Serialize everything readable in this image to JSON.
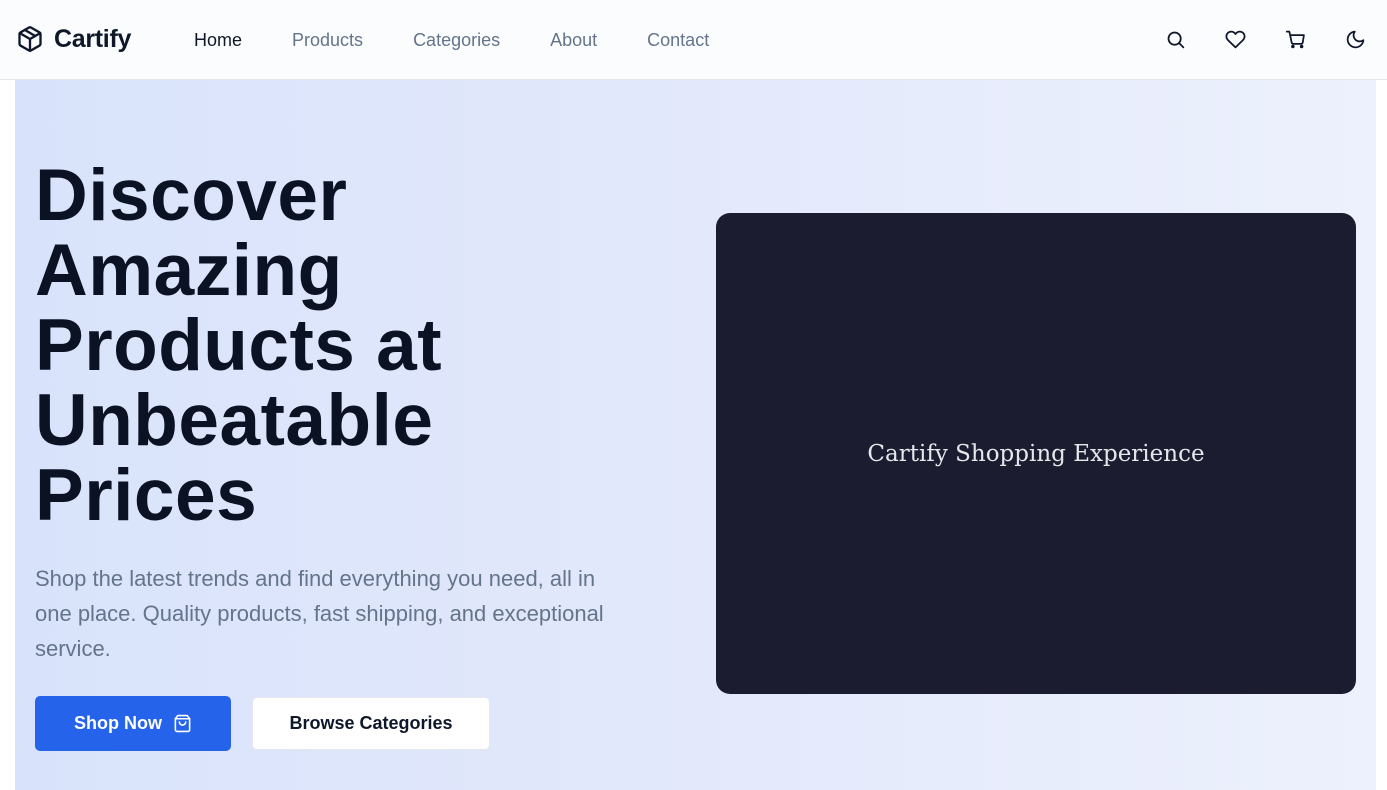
{
  "brand": {
    "name": "Cartify",
    "logo_icon": "box-icon"
  },
  "nav": {
    "items": [
      {
        "label": "Home",
        "active": true
      },
      {
        "label": "Products",
        "active": false
      },
      {
        "label": "Categories",
        "active": false
      },
      {
        "label": "About",
        "active": false
      },
      {
        "label": "Contact",
        "active": false
      }
    ],
    "icons": [
      "search-icon",
      "heart-icon",
      "cart-icon",
      "moon-icon"
    ]
  },
  "hero": {
    "title": "Discover Amazing Products at Unbeatable Prices",
    "subtitle": "Shop the latest trends and find everything you need, all in one place. Quality products, fast shipping, and exceptional service.",
    "primary_button": "Shop Now",
    "primary_button_icon": "shopping-bag-icon",
    "secondary_button": "Browse Categories",
    "media_caption": "Cartify Shopping Experience"
  },
  "colors": {
    "primary": "#2563eb",
    "text_dark": "#0b1223",
    "text_muted": "#64748b",
    "media_bg": "#1b1c2f"
  }
}
